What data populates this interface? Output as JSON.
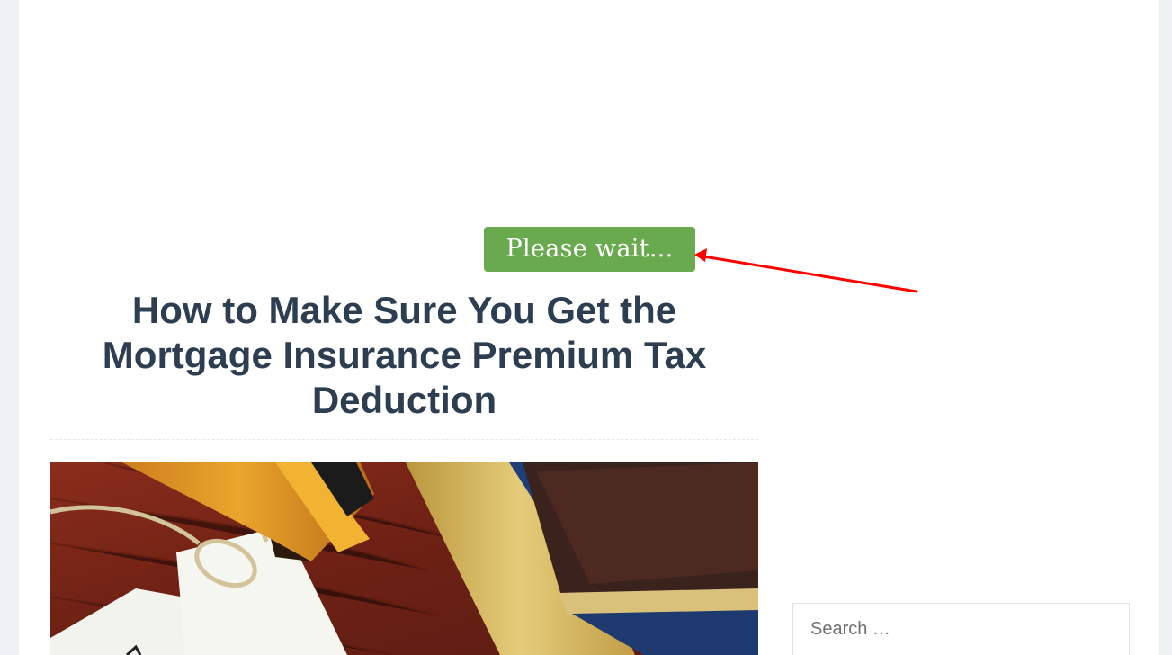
{
  "loading": {
    "button_label": "Please wait..."
  },
  "article": {
    "title": "How to Make Sure You Get the Mortgage Insurance Premium Tax Deduction",
    "featured_image": "mortgage-tax-documents-photo"
  },
  "sidebar": {
    "search": {
      "placeholder": "Search …"
    }
  },
  "annotation": {
    "type": "arrow",
    "color": "#ff0000",
    "target": "please-wait-button"
  },
  "colors": {
    "accent_green": "#6aaa4f",
    "title_text": "#2c3e50",
    "page_background": "#eef1f1",
    "content_background": "#ffffff"
  }
}
